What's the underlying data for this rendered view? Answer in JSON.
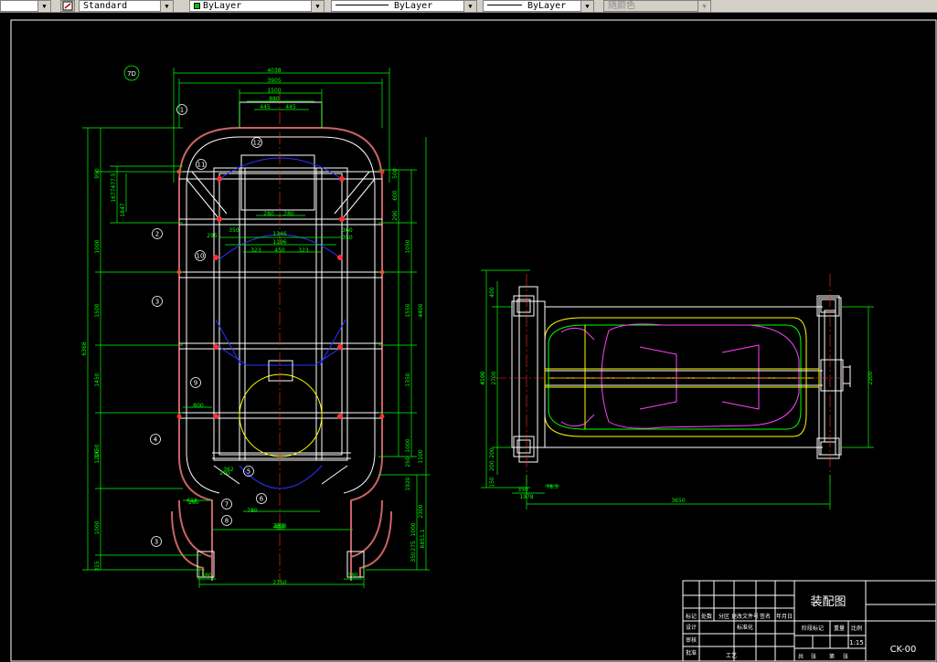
{
  "toolbar": {
    "style_name": "Standard",
    "layer_color": "ByLayer",
    "linetype": "ByLayer",
    "lineweight": "ByLayer",
    "plot_style": "随颜色"
  },
  "drawing": {
    "detail_id": "7D",
    "callouts": [
      "1",
      "2",
      "3",
      "9",
      "4",
      "3",
      "12",
      "11",
      "10",
      "7",
      "8",
      "6",
      "5"
    ],
    "dims_top": [
      "4038",
      "3905",
      "1500",
      "880",
      "445",
      "445"
    ],
    "dims_left": [
      "6368",
      "1000",
      "1500",
      "1450",
      "1450",
      "1000",
      "1200",
      "315",
      "950",
      "477.5",
      "1677",
      "1847"
    ],
    "dims_right": [
      "500",
      "600",
      "290",
      "1050",
      "1550",
      "1350",
      "1000",
      "250",
      "1100",
      "1920",
      "2300",
      "4400",
      "1000",
      "275",
      "6851.1",
      "350"
    ],
    "dims_inner": [
      "1346",
      "1196",
      "323",
      "450",
      "323",
      "280",
      "280",
      "350",
      "360",
      "800",
      "280",
      "380",
      "850",
      "613",
      "2300",
      "2750",
      "295",
      "350",
      "200",
      "362",
      "780"
    ],
    "side_dims": [
      "4100",
      "400",
      "4100",
      "2700",
      "2300",
      "3650",
      "200",
      "200",
      "150",
      "350",
      "1978",
      "78.5"
    ],
    "bottom_dims": [
      "380",
      "380"
    ]
  },
  "title_block": {
    "drawing_title": "装配图",
    "drawing_code": "CK-00",
    "scale": "1:15",
    "header_cells": [
      "标记",
      "处数",
      "分区",
      "更改文件号",
      "签名",
      "年月日"
    ],
    "role_rows": [
      "设计",
      "标准化",
      "审核",
      "工艺",
      "批准"
    ],
    "material_cells": [
      "阶段标记",
      "重量",
      "比例"
    ],
    "bottom_cells": [
      "共",
      "张",
      "第",
      "张"
    ]
  }
}
